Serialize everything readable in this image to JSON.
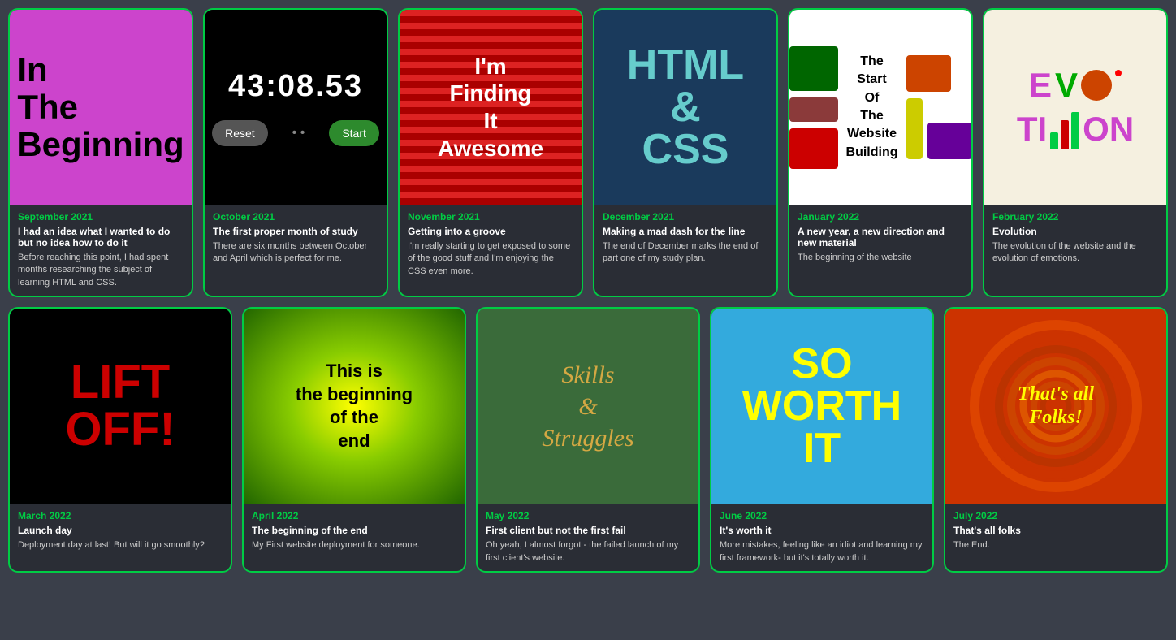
{
  "cards_row1": [
    {
      "id": "sep2021",
      "month": "September 2021",
      "image_text": "In The Beginning",
      "title": "I had an idea what I wanted to do but no idea how to do it",
      "desc1": "Before reaching this point, I had spent months researching the subject of learning HTML and CSS."
    },
    {
      "id": "oct2021",
      "month": "October 2021",
      "title": "The first proper month of study",
      "desc1": "There are six months between October and April which is perfect for me."
    },
    {
      "id": "nov2021",
      "month": "November 2021",
      "image_text": "I'm Finding It Awesome",
      "title": "Getting into a groove",
      "desc1": "I'm really starting to get exposed to some of the good stuff and I'm enjoying the CSS even more."
    },
    {
      "id": "dec2021",
      "month": "December 2021",
      "image_text": "HTML & CSS",
      "title": "Making a mad dash for the line",
      "desc1": "The end of December marks the end of part one of my study plan."
    },
    {
      "id": "jan2022",
      "month": "January 2022",
      "image_text": "The Start Of The Website Building",
      "title": "A new year, a new direction and new material",
      "desc1": "The beginning of the website"
    },
    {
      "id": "feb2022",
      "month": "February 2022",
      "image_text": "Evolution",
      "title": "Evolution",
      "desc1": "The evolution of the website and the evolution of emotions."
    }
  ],
  "cards_row2": [
    {
      "id": "mar2022",
      "month": "March 2022",
      "image_text": "LIFT OFF!",
      "title": "Launch day",
      "desc1": "Deployment day at last! But will it go smoothly?"
    },
    {
      "id": "apr2022",
      "month": "April 2022",
      "image_text": "This is the beginning of the end",
      "title": "The beginning of the end",
      "desc1": "My First website deployment for someone."
    },
    {
      "id": "may2022",
      "month": "May 2022",
      "image_text": "Skills & Struggles",
      "title": "First client but not the first fail",
      "desc1": "Oh yeah, I almost forgot - the failed launch of my first client's website."
    },
    {
      "id": "jun2022",
      "month": "June 2022",
      "image_text": "SO WORTH IT",
      "title": "It's worth it",
      "desc1": "More mistakes, feeling like an idiot and learning my first framework- but it's totally worth it."
    },
    {
      "id": "jul2022",
      "month": "July 2022",
      "image_text": "That's all Folks!",
      "title": "That's all folks",
      "desc1": "The End."
    }
  ],
  "timer": {
    "display": "43:08.53",
    "reset_label": "Reset",
    "start_label": "Start"
  }
}
